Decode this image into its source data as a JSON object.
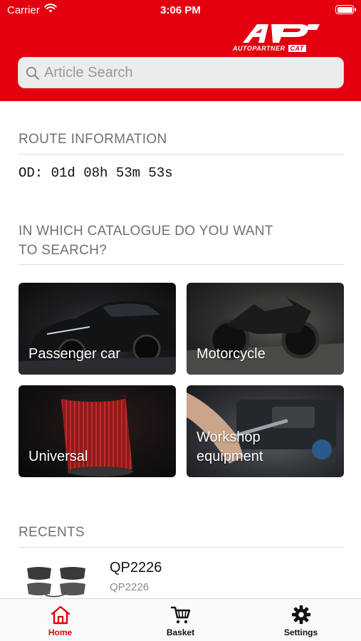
{
  "status_bar": {
    "carrier": "Carrier",
    "time": "3:06 PM",
    "wifi_icon": "wifi-icon",
    "battery_icon": "battery-icon"
  },
  "header": {
    "logo_name": "AUTOPARTNER",
    "logo_badge": "CAT",
    "brand_color": "#e3000f"
  },
  "search": {
    "placeholder": "Article Search",
    "icon": "search-icon"
  },
  "route": {
    "title": "ROUTE INFORMATION",
    "value": "OD: 01d 08h 53m 53s"
  },
  "catalogue": {
    "title_line1": "IN WHICH CATALOGUE DO YOU WANT",
    "title_line2": "TO SEARCH?",
    "tiles": [
      {
        "label": "Passenger car"
      },
      {
        "label": "Motorcycle"
      },
      {
        "label": "Universal"
      },
      {
        "label_line1": "Workshop",
        "label_line2": "equipment"
      }
    ]
  },
  "recents": {
    "title": "RECENTS",
    "items": [
      {
        "title": "QP2226",
        "subtitle": "QP2226"
      }
    ]
  },
  "tabbar": {
    "active_color": "#e3000f",
    "tabs": [
      {
        "label": "Home",
        "icon": "home-icon",
        "active": true
      },
      {
        "label": "Basket",
        "icon": "cart-icon",
        "active": false
      },
      {
        "label": "Settings",
        "icon": "gear-icon",
        "active": false
      }
    ]
  }
}
